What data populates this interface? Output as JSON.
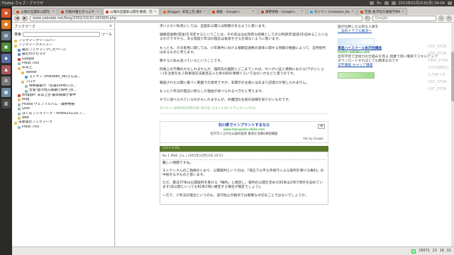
{
  "system": {
    "window_title": "Firefox ウェブ・ブラウザ",
    "clock": "2013年02月25日(月) 04:04",
    "keyboard": "En"
  },
  "browser": {
    "tabs": [
      {
        "label": "公報の全面非公開を要請：元検弁護士の"
      },
      {
        "label": "元検弁護士のつぶやき"
      },
      {
        "label": "公報の全面非公開を要請：元検弁護士のつぶやき"
      },
      {
        "label": "Blogger: 非常上告-最高検察庁御中"
      },
      {
        "label": "検索 - Google+"
      },
      {
        "label": "廣野秀樹 - Google+"
      },
      {
        "label": "モトケン (motoken_tw)さんは..."
      },
      {
        "label": "告発-金沢地方検察庁御中..."
      }
    ],
    "active_tab_index": 2,
    "url": "www.yabelab.net/blog/2002/10/10-182900.php",
    "search_placeholder": "Google"
  },
  "sidebar": {
    "header": "ブックマーク",
    "close_glyph": "×",
    "search_label": "検索",
    "view_label": "ツール",
    "items": [
      {
        "label": "ブックマークツールバー",
        "indent": 0,
        "icon": "folder"
      },
      {
        "label": "ブックマークメニュー",
        "indent": 0,
        "icon": "folder"
      },
      {
        "label": "最近ブックマークしたページ",
        "indent": 1,
        "icon": "star"
      },
      {
        "label": "最近付けたタグ",
        "indent": 1,
        "icon": "star"
      },
      {
        "label": "Google",
        "indent": 1,
        "icon": "g"
      },
      {
        "label": "Press This",
        "indent": 1,
        "icon": "page"
      },
      {
        "label": "非常上",
        "indent": 1,
        "icon": "folder"
      },
      {
        "label": "Twitter",
        "indent": 2,
        "icon": "folder"
      },
      {
        "label": "モトケン (motoken_tw)さんは...",
        "indent": 3,
        "icon": "tw"
      },
      {
        "label": "ブログ",
        "indent": 2,
        "icon": "folder"
      },
      {
        "label": "特捜検察が「普通の中所に示...",
        "indent": 3,
        "icon": "page"
      },
      {
        "label": "告発-金沢地方検察庁御中_loi...",
        "indent": 3,
        "icon": "page"
      },
      {
        "label": "Blogger: 非常上告-最高検察庁御中",
        "indent": 1,
        "icon": "g"
      },
      {
        "label": "blog",
        "indent": 1,
        "icon": "folder"
      },
      {
        "label": "Picasa ウェブアルバム - 廣野秀樹",
        "indent": 1,
        "icon": "page"
      },
      {
        "label": "Quix",
        "indent": 1,
        "icon": "page"
      },
      {
        "label": "はてなブックマーク - hiroos2011のブ...",
        "indent": 1,
        "icon": "page"
      },
      {
        "label": "web",
        "indent": 1,
        "icon": "folder"
      },
      {
        "label": "未整理のブックマーク",
        "indent": 0,
        "icon": "folder"
      },
      {
        "label": "Press This",
        "indent": 1,
        "icon": "page"
      }
    ]
  },
  "article": {
    "paragraphs": [
      "求い小さい私見にしては、全面非公開には問題があるように思います。",
      "検察官送致(逆送)を決定するということは、その非はは必然的な結果としての公判請求(起訴)を認めることになるわけですから、ある程度少年法の理念は後退せざるを得ないように思います。",
      "もっとも、その意見に関しては、少年事件における検察官送致の意味に関する見解の相違によって、当然批判はあるものと考えます。",
      "要するに私も迷っているということです。",
      "刑事上の不備のかもしれませんが、理研去の国民とどこまでしれば、せいぜい証人尋問における(デポジション)を注意を払う刑事訴訟法第百五十七条の四の事柄ぐらいではないかなどと思うのです。",
      "報道された公開に基づく範囲での意見ですが、非開示の主張にはあまり説得力が感じられません。",
      "もっと少年法の理念に照らした理由が述べられるべきだと考えます。",
      "すでに述べられているのかもしれませんが、弁護団の主張の詳細を知りたいものです。"
    ],
    "meta": "モトケン (2005年10月15日 10:25) コメント(5) トラックバック(1)",
    "ad": {
      "title": "石川県でインプラントするなら",
      "url": "www.maruyama-shika.com",
      "desc": "金沢市入江の丸山歯科医院 最適な治療&精密機器",
      "ads_by": "Ads by Google",
      "arrow": "➜"
    },
    "comments_header": "コメント(5)",
    "comment": {
      "head": "No.1 PINE さん | 2005年10月15日 20:51",
      "paragraphs": [
        "難しい問題ですね。",
        "モトケンさんのご指摘のとおり、公開裁判というのは、「適正で公平な手続きによる裁判を受ける権利」の中核をなすものと思います。",
        "ただ、憲法37条は公開裁判を受ける「権利」と規定し、裁判の公開を定めた82条は2項で例外を認めています(非公開といっても82条2項に規定する場合が限定でしょう)。",
        "一方で、少年法の理念というのも、非行防止の観点では重要な大切なことではないでしょうか。"
      ]
    }
  },
  "right_column": {
    "blocks": [
      {
        "text": "国が拉致した公的な人数を",
        "link": "、法科トラブル解決へ"
      },
      {
        "text": "",
        "link": "東進ハイスクール金沢校講座"
      },
      {
        "text": "toshin-zaitaku.com",
        "link": ""
      },
      {
        "text": "自宅学習で全体力の仕組みを見る 授業で高い確率でスキルアップ",
        "link": ""
      },
      {
        "text": "ダウンロードすればとても簡単なのです",
        "link": "法学講座 キャリア講座"
      }
    ],
    "ghost_lines": [
      "LIST_STOR",
      "LIST_STOR",
      "ITEM_STOR",
      "テの代表的な",
      "ルや気づき",
      "LIST_STOR",
      "LIST_STOR"
    ]
  },
  "status": {
    "item_count": "16072",
    "count_a": "23",
    "count_b": "18",
    "zoom": "01"
  }
}
